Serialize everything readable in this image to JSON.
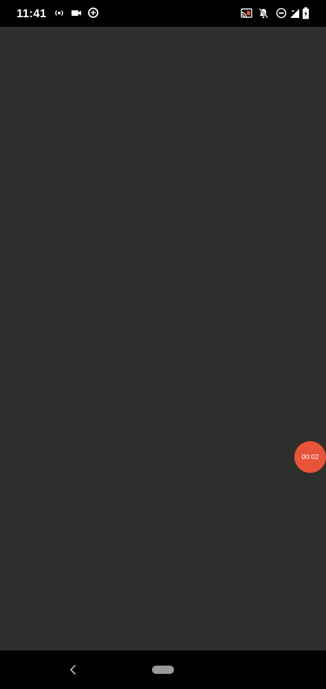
{
  "status_bar": {
    "time": "11:41",
    "left_icons": [
      "hotspot-icon",
      "video-camera-icon",
      "data-saver-icon"
    ],
    "right_icons": [
      "cast-icon",
      "notifications-off-icon",
      "do-not-disturb-icon",
      "signal-icon",
      "battery-icon"
    ]
  },
  "screen_record": {
    "timer": "00:02",
    "color": "#e8533a"
  },
  "nav_bar": {
    "icons": [
      "back-icon",
      "home-pill-icon"
    ]
  },
  "colors": {
    "content_background": "#2d2f2c",
    "bars": "#000000"
  }
}
